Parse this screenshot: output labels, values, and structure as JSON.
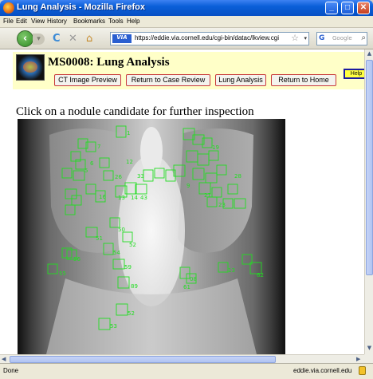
{
  "window": {
    "title": "Lung Analysis - Mozilla Firefox"
  },
  "menu": [
    "File",
    "Edit",
    "View",
    "History",
    "Bookmarks",
    "Tools",
    "Help"
  ],
  "nav": {
    "url": "https://eddie.via.cornell.edu/cgi-bin/datac/lkview.cgi",
    "site_badge": "VIA",
    "search_placeholder": "Google",
    "search_engine": "G"
  },
  "page": {
    "title": "MS0008: Lung Analysis",
    "buttons": [
      "CT Image Preview",
      "Return to Case Review",
      "Lung Analysis",
      "Return to Home"
    ],
    "help": "Help",
    "instruction": "Click on a nodule candidate for further inspection"
  },
  "nodule_labels": {
    "large": [
      "1",
      "7",
      "6",
      "5",
      "16",
      "12",
      "13",
      "14",
      "33",
      "43",
      "26",
      "52",
      "54",
      "55",
      "56",
      "59",
      "53",
      "61",
      "62",
      "89",
      "08",
      "13"
    ],
    "color": "#22dd22"
  },
  "status": {
    "text": "Done",
    "domain": "eddie.via.cornell.edu"
  },
  "colors": {
    "title_bar": "#0a5fd8",
    "header_bg": "#ffffc8",
    "marker": "#22dd22"
  }
}
